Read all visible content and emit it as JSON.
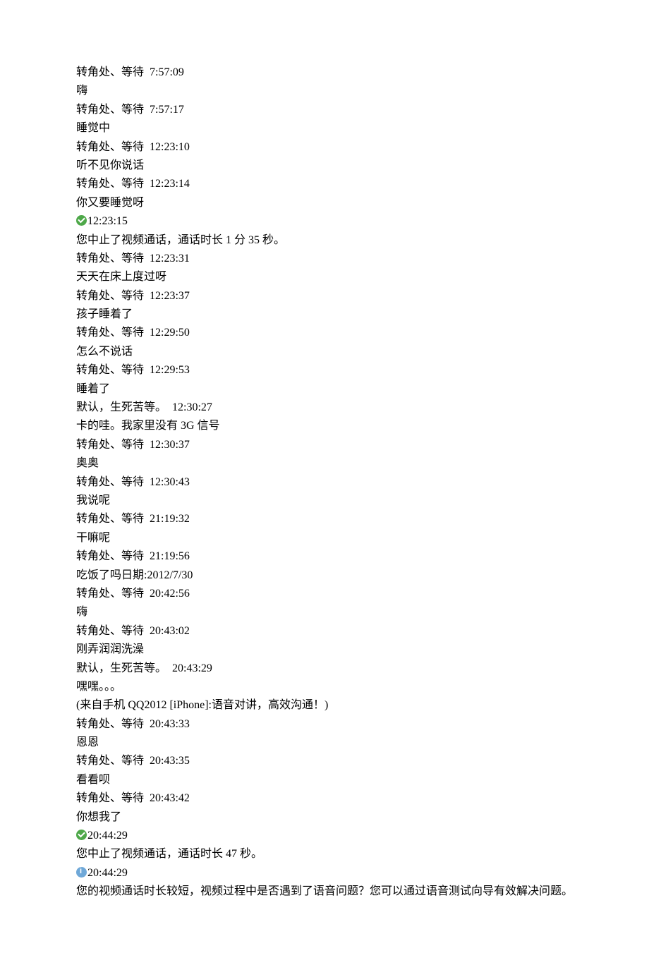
{
  "messages": [
    {
      "kind": "msg",
      "name": "转角处、等待",
      "time": "7:57:09",
      "content": "嗨"
    },
    {
      "kind": "msg",
      "name": "转角处、等待",
      "time": "7:57:17",
      "content": "睡觉中"
    },
    {
      "kind": "msg",
      "name": "转角处、等待",
      "time": "12:23:10",
      "content": "听不见你说话"
    },
    {
      "kind": "msg",
      "name": "转角处、等待",
      "time": "12:23:14",
      "content": "你又要睡觉呀"
    },
    {
      "kind": "system",
      "icon": "green",
      "time": "12:23:15",
      "content": "您中止了视频通话，通话时长 1 分 35 秒。"
    },
    {
      "kind": "msg",
      "name": "转角处、等待",
      "time": "12:23:31",
      "content": "天天在床上度过呀"
    },
    {
      "kind": "msg",
      "name": "转角处、等待",
      "time": "12:23:37",
      "content": "孩子睡着了"
    },
    {
      "kind": "msg",
      "name": "转角处、等待",
      "time": "12:29:50",
      "content": "怎么不说话"
    },
    {
      "kind": "msg",
      "name": "转角处、等待",
      "time": "12:29:53",
      "content": "睡着了"
    },
    {
      "kind": "msg",
      "name": "默认，生死苦等。",
      "time": "12:30:27",
      "content": "卡的哇。我家里没有 3G 信号"
    },
    {
      "kind": "msg",
      "name": "转角处、等待",
      "time": "12:30:37",
      "content": "奥奥"
    },
    {
      "kind": "msg",
      "name": "转角处、等待",
      "time": "12:30:43",
      "content": "我说呢"
    },
    {
      "kind": "msg",
      "name": "转角处、等待",
      "time": "21:19:32",
      "content": "干嘛呢"
    },
    {
      "kind": "msg",
      "name": "转角处、等待",
      "time": "21:19:56",
      "content": "吃饭了吗日期:2012/7/30"
    },
    {
      "kind": "msg",
      "name": "转角处、等待",
      "time": "20:42:56",
      "content": "嗨"
    },
    {
      "kind": "msg",
      "name": "转角处、等待",
      "time": "20:43:02",
      "content": "刚弄润润洗澡"
    },
    {
      "kind": "msg",
      "name": "默认，生死苦等。",
      "time": "20:43:29",
      "content": "嘿嘿。。。",
      "content2": "(来自手机 QQ2012  [iPhone]:语音对讲，高效沟通！)"
    },
    {
      "kind": "msg",
      "name": "转角处、等待",
      "time": "20:43:33",
      "content": "恩恩"
    },
    {
      "kind": "msg",
      "name": "转角处、等待",
      "time": "20:43:35",
      "content": "看看呗"
    },
    {
      "kind": "msg",
      "name": "转角处、等待",
      "time": "20:43:42",
      "content": "你想我了"
    },
    {
      "kind": "system",
      "icon": "green",
      "time": "20:44:29",
      "content": "您中止了视频通话，通话时长 47 秒。"
    },
    {
      "kind": "system",
      "icon": "blue",
      "time": "20:44:29",
      "content": "您的视频通话时长较短，视频过程中是否遇到了语音问题？您可以通过语音测试向导有效解决问题。"
    }
  ]
}
